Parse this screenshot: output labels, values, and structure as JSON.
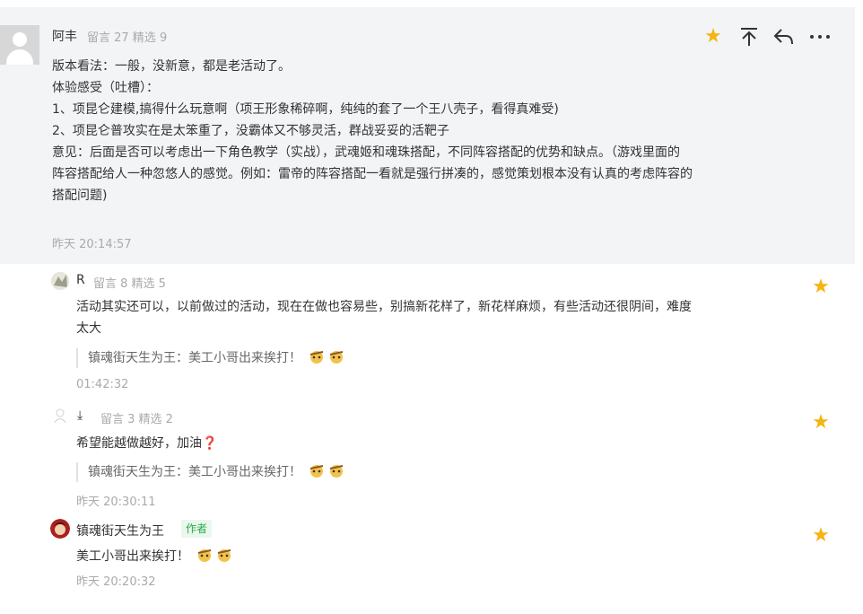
{
  "colors": {
    "accent_star": "#f5b40f",
    "author_tag": "#2aa84a",
    "muted": "#aaaaaa"
  },
  "main": {
    "user": "阿丰",
    "stats": "留言 27 精选 9",
    "lines": [
      "版本看法：一般，没新意，都是老活动了。",
      "体验感受（吐槽）：",
      "1、项昆仑建模,搞得什么玩意啊（项王形象稀碎啊，纯纯的套了一个王八壳子，看得真难受)",
      "2、项昆仑普攻实在是太笨重了，没霸体又不够灵活，群战妥妥的活靶子",
      "意见：后面是否可以考虑出一下角色教学（实战），武魂姬和魂珠搭配，不同阵容搭配的优势和缺点。（游戏里面的",
      "阵容搭配给人一种忽悠人的感觉。例如：雷帝的阵容搭配一看就是强行拼凑的，感觉策划根本没有认真的考虑阵容的",
      "搭配问题)"
    ],
    "time": "昨天 20:14:57",
    "action_icons": [
      "star-icon",
      "pin-top-icon",
      "reply-icon",
      "more-icon"
    ]
  },
  "replies": [
    {
      "user": "R",
      "stats": "留言 8 精选 5",
      "text_lines": [
        "活动其实还可以，以前做过的活动，现在在做也容易些，别搞新花样了，新花样麻烦，有些活动还很阴间，难度",
        "太大"
      ],
      "quote": "镇魂街天生为王：美工小哥出来挨打！",
      "time": "01:42:32"
    },
    {
      "user": "⤓",
      "stats": "留言 3 精选 2",
      "text": "希望能越做越好，加油",
      "text_emoji": "❓",
      "quote": "镇魂街天生为王：美工小哥出来挨打！",
      "time": "昨天 20:30:11"
    },
    {
      "user": "镇魂街天生为王",
      "tag": "作者",
      "text": "美工小哥出来挨打！",
      "time": "昨天 20:20:32"
    }
  ]
}
